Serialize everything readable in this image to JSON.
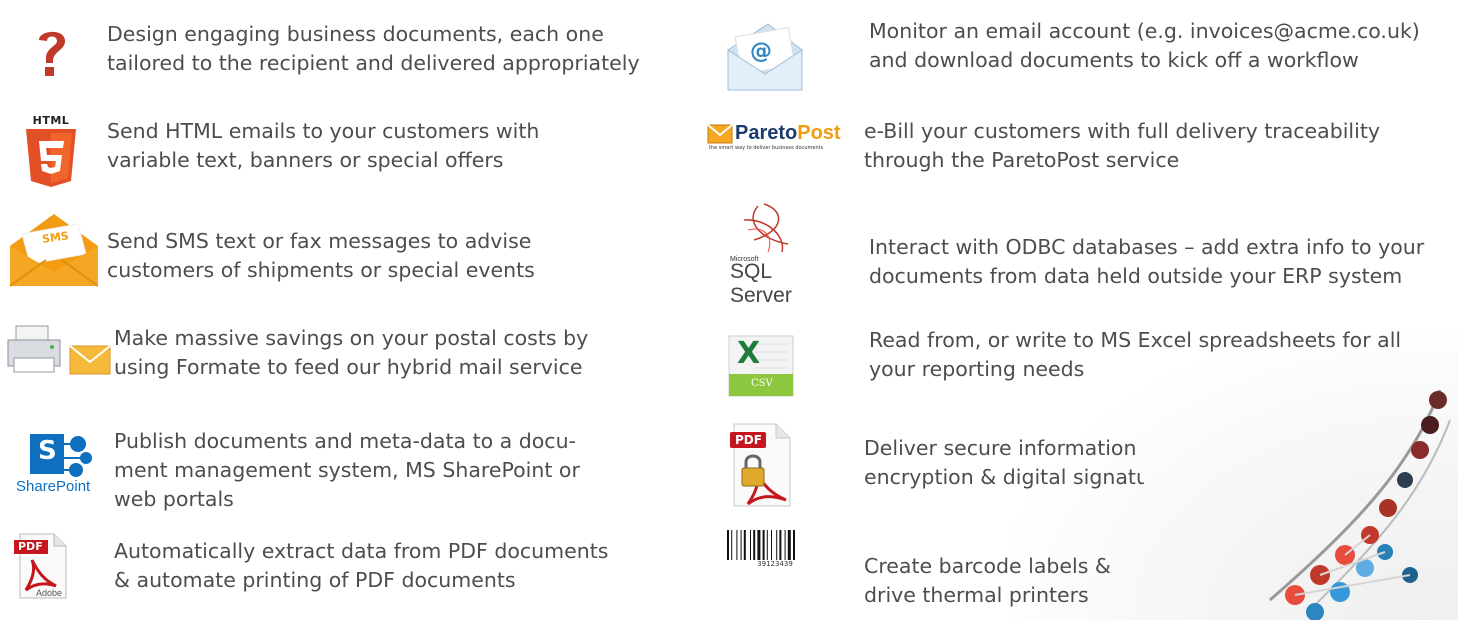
{
  "left": [
    {
      "icon": "question-icon",
      "lines": [
        "Design engaging business documents, each one",
        "tailored to the recipient and delivered appropriately"
      ]
    },
    {
      "icon": "html5-icon",
      "icon_label": "HTML",
      "lines": [
        "Send HTML emails to your customers with",
        "variable text, banners or special offers"
      ]
    },
    {
      "icon": "sms-envelope-icon",
      "icon_label": "SMS",
      "lines": [
        "Send SMS text or fax messages to advise",
        "customers of shipments or special events"
      ]
    },
    {
      "icon": "printer-mail-icon",
      "lines": [
        "Make massive savings on your postal costs by",
        "using Formate to feed our hybrid mail service"
      ]
    },
    {
      "icon": "sharepoint-icon",
      "icon_label": "SharePoint",
      "icon_letter": "S",
      "lines": [
        "Publish documents and meta-data to a docu-",
        "ment management system, MS SharePoint or",
        "web portals"
      ]
    },
    {
      "icon": "pdf-adobe-icon",
      "icon_label": "PDF",
      "icon_sub": "Adobe",
      "lines": [
        "Automatically extract data from PDF documents",
        "& automate printing of PDF documents"
      ]
    }
  ],
  "right": [
    {
      "icon": "email-envelope-icon",
      "lines": [
        "Monitor an email account (e.g. invoices@acme.co.uk)",
        "and download documents to kick off a workflow"
      ]
    },
    {
      "icon": "paretopost-logo-icon",
      "logo_a": "Pareto",
      "logo_b": "Post",
      "logo_tag": "the smart way to deliver business documents",
      "lines": [
        "e-Bill your customers with full delivery traceability",
        "through the ParetoPost service"
      ]
    },
    {
      "icon": "sql-server-icon",
      "logo_small": "Microsoft",
      "logo_main": "SQL Server",
      "lines": [
        "Interact with ODBC databases – add extra info to your",
        "documents from data held outside your ERP system"
      ]
    },
    {
      "icon": "excel-csv-icon",
      "icon_letter": "X",
      "icon_label": "CSV",
      "lines": [
        "Read from, or write to MS Excel spreadsheets for all",
        "your reporting needs"
      ]
    },
    {
      "icon": "pdf-lock-icon",
      "icon_label": "PDF",
      "lines": [
        "Deliver secure information",
        "encryption & digital signatu"
      ]
    },
    {
      "icon": "barcode-icon",
      "icon_label": "39123439",
      "lines": [
        "Create barcode labels &",
        "drive thermal printers"
      ]
    }
  ],
  "colors": {
    "text": "#4d4d4d",
    "question": "#c0392b",
    "html5": "#e34f26",
    "sms": "#f39c12",
    "sharepoint": "#0e6fbe",
    "excel": "#1e7d3c",
    "pdf": "#c4161c"
  }
}
